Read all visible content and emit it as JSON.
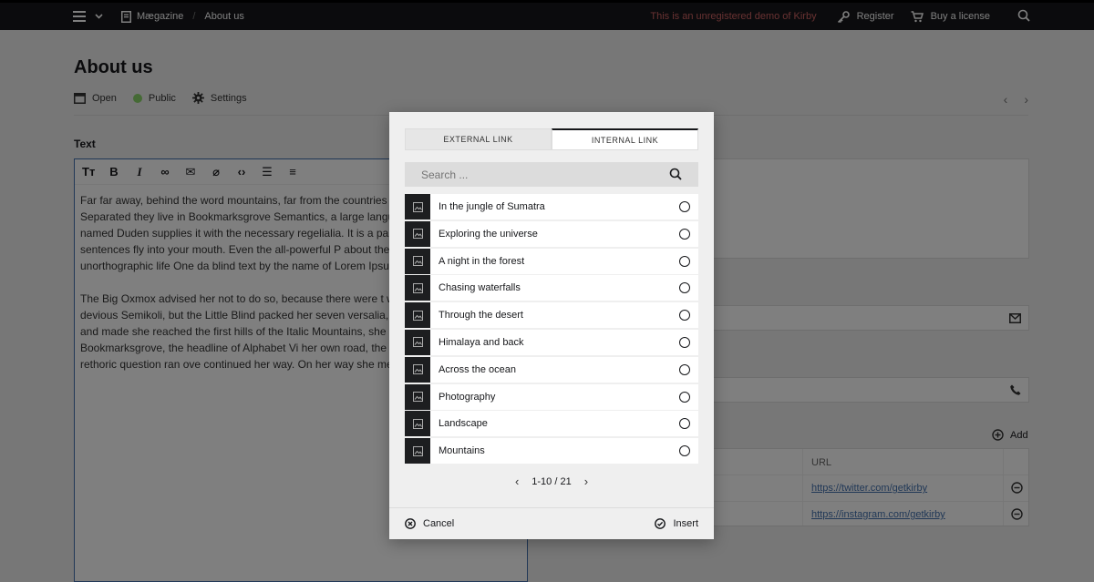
{
  "topbar": {
    "site_name": "Mægazine",
    "breadcrumb_page": "About us",
    "demo_notice": "This is an unregistered demo of Kirby",
    "register_label": "Register",
    "buy_label": "Buy a license",
    "demo_color": "#d16464"
  },
  "page": {
    "title": "About us",
    "actions": [
      {
        "label": "Open",
        "icon": "open-icon"
      },
      {
        "label": "Public",
        "icon": "status-dot"
      },
      {
        "label": "Settings",
        "icon": "gear-icon"
      }
    ]
  },
  "editor": {
    "label": "Text",
    "paragraphs": [
      "Far far away, behind the word mountains, far from the countries there live the blind texts. Separated they live in Bookmarksgrove Semantics, a large language ocean. A small river named Duden supplies it with the necessary regelialia. It is a paradisematic c parts of sentences fly into your mouth. Even the all-powerful P about the blind texts it is an almost unorthographic life One da blind text by the name of Lorem Ipsum decided to leave for the",
      "The Big Oxmox advised her not to do so, because there were t wild Question Marks and devious Semikoli, but the Little Blind packed her seven versalia, put her initial into the belt and made she reached the first hills of the Italic Mountains, she had a las of her hometown Bookmarksgrove, the headline of Alphabet Vi her own road, the Line Lane. Pityful a rethoric question ran ove continued her way. On her way she met a copy."
    ]
  },
  "side": {
    "add_label": "Add",
    "table_header_url": "URL",
    "urls": [
      "https://twitter.com/getkirby",
      "https://instagram.com/getkirby"
    ]
  },
  "dialog": {
    "tabs": [
      "EXTERNAL LINK",
      "INTERNAL LINK"
    ],
    "search_placeholder": "Search ...",
    "items": [
      "In the jungle of Sumatra",
      "Exploring the universe",
      "A night in the forest",
      "Chasing waterfalls",
      "Through the desert",
      "Himalaya and back",
      "Across the ocean",
      "Photography",
      "Landscape",
      "Mountains"
    ],
    "pagination": "1-10 / 21",
    "cancel_label": "Cancel",
    "insert_label": "Insert"
  }
}
